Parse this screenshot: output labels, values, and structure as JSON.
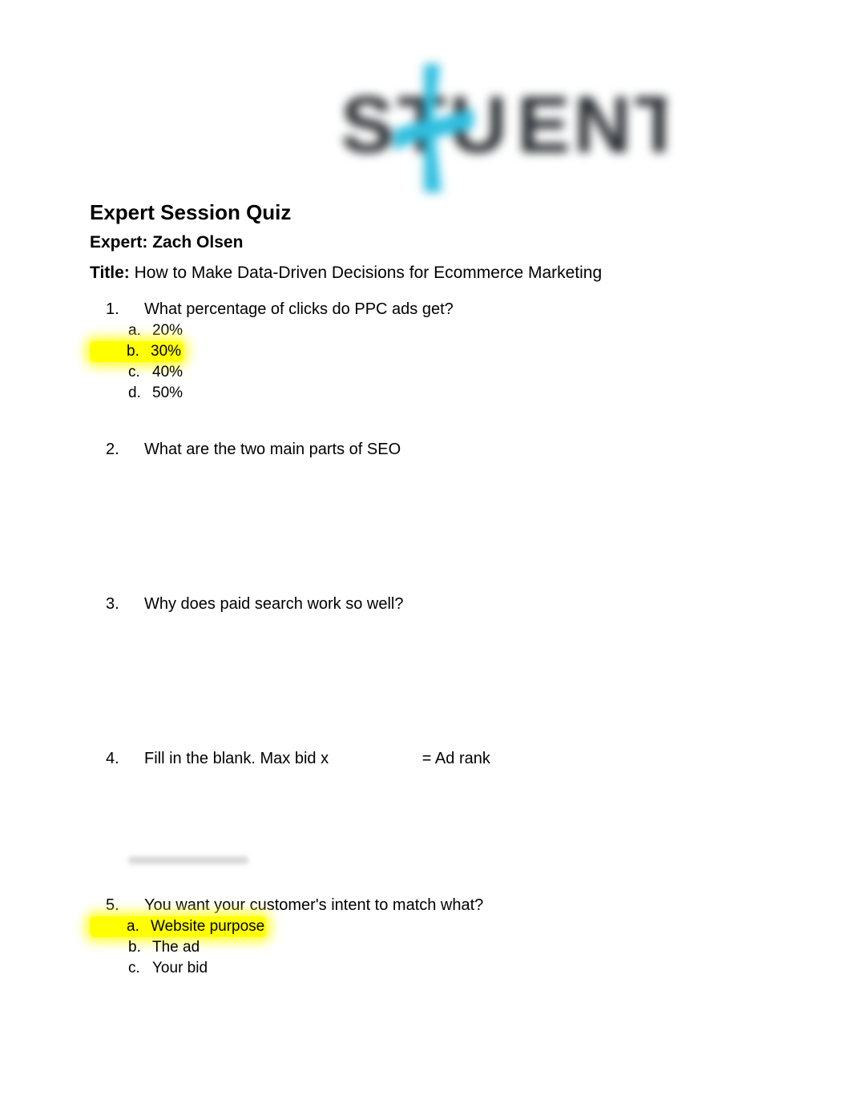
{
  "logo_text": "STUKENT",
  "header": "Expert Session Quiz",
  "expert_label": "Expert:",
  "expert_name": "Zach Olsen",
  "title_label": "Title:",
  "title_text": "How to Make Data-Driven Decisions for Ecommerce Marketing",
  "questions": [
    {
      "num": "1.",
      "text": "What percentage of clicks do PPC ads get?",
      "options": [
        {
          "mark": "a.",
          "text": "20%",
          "hl": false
        },
        {
          "mark": "b.",
          "text": "30%",
          "hl": true
        },
        {
          "mark": "c.",
          "text": "40%",
          "hl": false
        },
        {
          "mark": "d.",
          "text": "50%",
          "hl": false
        }
      ]
    },
    {
      "num": "2.",
      "text": "What are the two main parts of SEO",
      "options": []
    },
    {
      "num": "3.",
      "text": "Why does paid search work so well?",
      "options": []
    },
    {
      "num": "4.",
      "text": "Fill in the blank. Max bid x                     = Ad rank",
      "options": []
    },
    {
      "num": "5.",
      "text": "You want your customer's intent to match what?",
      "options": [
        {
          "mark": "a.",
          "text": "Website purpose",
          "hl": true
        },
        {
          "mark": "b.",
          "text": "The ad",
          "hl": false
        },
        {
          "mark": "c.",
          "text": "Your bid",
          "hl": false
        }
      ]
    }
  ]
}
